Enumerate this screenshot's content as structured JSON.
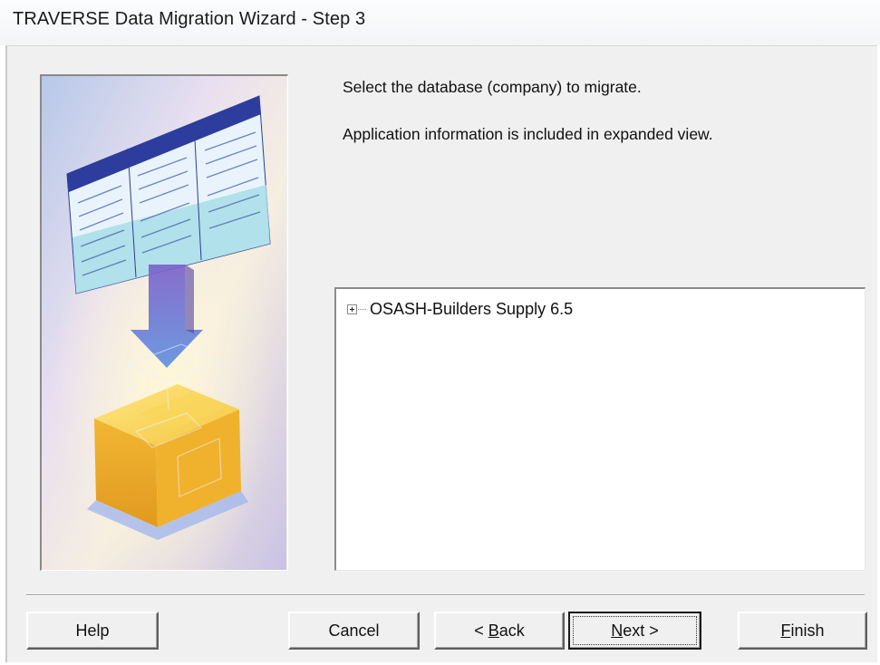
{
  "window": {
    "title": "TRAVERSE Data Migration Wizard - Step 3"
  },
  "instructions": {
    "line1": "Select the database (company) to migrate.",
    "line2": "Application information is included in expanded view."
  },
  "tree": {
    "items": [
      {
        "label": "OSASH-Builders Supply 6.5",
        "expanded": false
      }
    ]
  },
  "buttons": {
    "help": "Help",
    "cancel": "Cancel",
    "back_prefix": "< ",
    "back_mnemonic": "B",
    "back_rest": "ack",
    "next_mnemonic": "N",
    "next_rest": "ext >",
    "finish_mnemonic": "F",
    "finish_rest": "inish"
  },
  "icons": {
    "tree_expander": "plus-box-icon",
    "illustration": "database-migration-illustration"
  }
}
